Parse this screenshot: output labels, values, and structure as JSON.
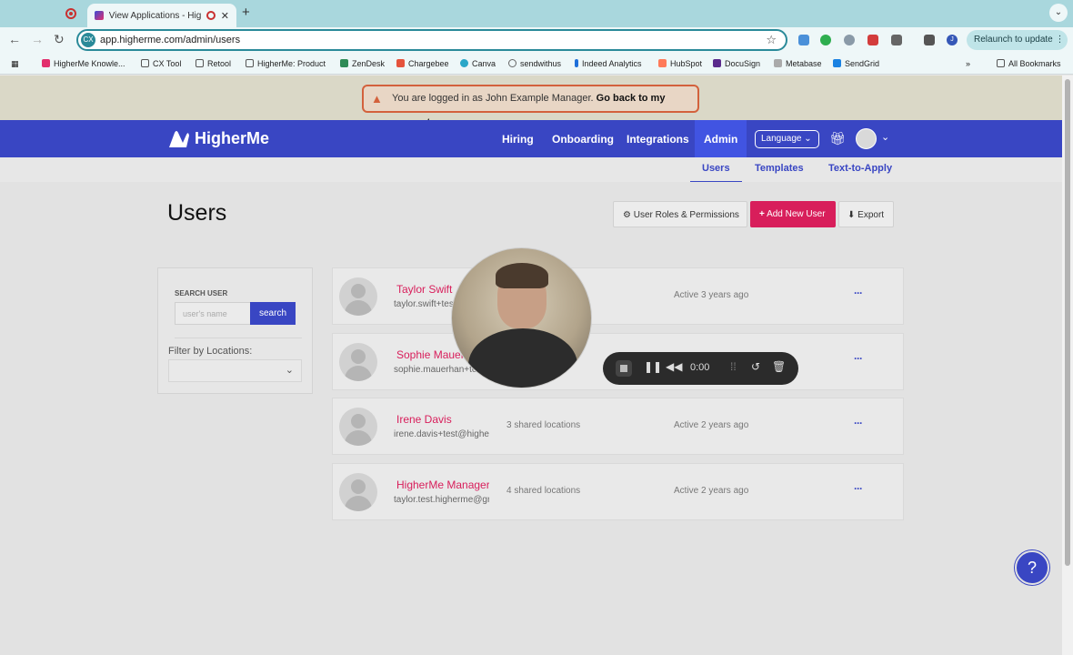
{
  "browser": {
    "tab_title": "View Applications - HigherMe",
    "tab_close": "✕",
    "new_tab": "+",
    "url": "app.higherme.com/admin/users",
    "relaunch_label": "Relaunch to update",
    "bookmarks": [
      "HigherMe Knowle...",
      "CX Tool",
      "Retool",
      "HigherMe: Product",
      "ZenDesk",
      "Chargebee",
      "Canva",
      "sendwithus",
      "Indeed Analytics",
      "HubSpot",
      "DocuSign",
      "Metabase",
      "SendGrid"
    ],
    "all_bookmarks": "All Bookmarks",
    "overflow": "»",
    "profile_initial": "J"
  },
  "alert": {
    "message": "You are logged in as John Example Manager.",
    "link": "Go back to my account."
  },
  "nav": {
    "brand": "HigherMe",
    "links": [
      "Hiring",
      "Onboarding",
      "Integrations",
      "Admin"
    ],
    "language": "Language"
  },
  "subnav": [
    "Users",
    "Templates",
    "Text-to-Apply"
  ],
  "page": {
    "title": "Users",
    "roles_button": "User Roles & Permissions",
    "add_button": "Add New User",
    "export_button": "Export"
  },
  "filter": {
    "search_label": "SEARCH USER",
    "search_placeholder": "user's name",
    "search_button": "search",
    "locations_label": "Filter by Locations:"
  },
  "users": [
    {
      "name": "Taylor Swift",
      "email": "taylor.swift+test@higherme.com",
      "locations": "",
      "status": "Active 3 years ago"
    },
    {
      "name": "Sophie Mauerhan",
      "email": "sophie.mauerhan+test@higherme.com",
      "locations": "",
      "status": ""
    },
    {
      "name": "Irene Davis",
      "email": "irene.davis+test@higherme.com",
      "locations": "3 shared locations",
      "status": "Active 2 years ago"
    },
    {
      "name": "HigherMe Manager",
      "email": "taylor.test.higherme@gmail.com",
      "locations": "4 shared locations",
      "status": "Active 2 years ago"
    }
  ],
  "recorder": {
    "time": "0:00"
  },
  "colors": {
    "brand": "#3946c3",
    "accent": "#d81e5b",
    "warning": "#d3613c"
  }
}
